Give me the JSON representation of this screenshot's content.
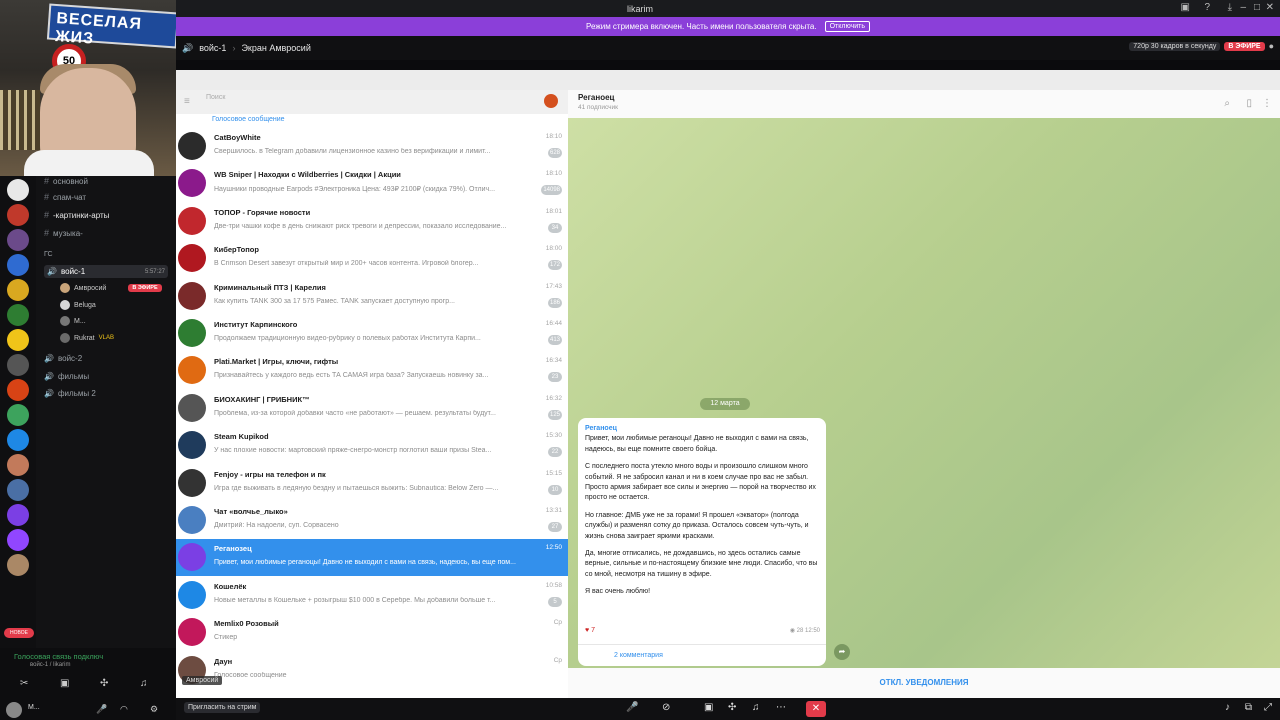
{
  "window": {
    "title": "likarim"
  },
  "stream_banner": {
    "text": "Режим стримера включен. Часть имени пользователя скрыта.",
    "button": "Отключить"
  },
  "voice_header": {
    "channel": "войс-1",
    "screen": "Экран Амвросий",
    "quality": "720p 30 кадров в секунду",
    "live": "В ЭФИРЕ"
  },
  "webcam": {
    "sign_text": "ВЕСЕЛАЯ ЖИЗ",
    "road_sign": "50"
  },
  "discord_channels": [
    {
      "label": "основной"
    },
    {
      "label": "спам-чат"
    },
    {
      "label": "-картинки-арты"
    },
    {
      "label": "музыка-"
    }
  ],
  "discord_group": "ГС",
  "voice_channel": {
    "label": "войс-1",
    "timer": "5:57:27"
  },
  "voice_users": [
    {
      "name": "Амвросий",
      "badge": "В ЭФИРЕ"
    },
    {
      "name": "Beluga"
    },
    {
      "name": "М..."
    },
    {
      "name": "Rukrat",
      "badge": "VLAB"
    }
  ],
  "other_voice": [
    {
      "label": "войс-2"
    },
    {
      "label": "фильмы"
    },
    {
      "label": "фильмы 2"
    }
  ],
  "discord_footer": {
    "status": "Голосовая связь подключ",
    "sub": "войс-1 / likarim",
    "user": "M..."
  },
  "invite_button": "Пригласить на стрим",
  "telegram": {
    "search_placeholder": "Поиск",
    "top_voice": "Голосовое сообщение",
    "chats": [
      {
        "name": "CatBoyWhite",
        "preview": "Свершилось. в Telegram добавили лицензионное казино без верификации и лимит...",
        "time": "18:10",
        "badge": "628"
      },
      {
        "name": "WB Sniper | Находки с Wildberries | Скидки | Акции",
        "preview": "Наушники проводные Earpods #Электроника Цена: 493₽ 2100₽ (скидка 79%). Отлич...",
        "time": "18:10",
        "badge": "14098"
      },
      {
        "name": "ТОПОР - Горячие новости",
        "preview": "Две-три чашки кофе в день снижают риск тревоги и депрессии, показало исследование...",
        "time": "18:01",
        "badge": "34"
      },
      {
        "name": "КиберТопор",
        "preview": "В Crimson Desert завезут открытый мир и 200+ часов контента. Игровой блогер...",
        "time": "18:00",
        "badge": "172"
      },
      {
        "name": "Криминальный ПТЗ | Карелия",
        "preview": "Как купить TANK 300 за 17 575 Рамес. TANK запускает доступную прогр...",
        "time": "17:43",
        "badge": "186"
      },
      {
        "name": "Институт Карпинского",
        "preview": "Продолжаем традиционную видео-рубрику о полевых работах Института Карпи...",
        "time": "16:44",
        "badge": "413"
      },
      {
        "name": "Plati.Market | Игры, ключи, гифты",
        "preview": "Признавайтесь у каждого ведь есть ТА САМАЯ игра база? Запускаешь новинку за...",
        "time": "16:34",
        "badge": "23"
      },
      {
        "name": "БИОХАКИНГ | ГРИБНИК™",
        "preview": "Проблема, из-за которой добавки часто «не работают» — решаем. результаты будут...",
        "time": "16:32",
        "badge": "125"
      },
      {
        "name": "Steam Kupikod",
        "preview": "У нас плохие новости: мартовский пряже-снегро-монстр поглотил ваши призы Stea...",
        "time": "15:30",
        "badge": "22"
      },
      {
        "name": "Fenjoy - игры на телефон и пк",
        "preview": "Игра где выживать в ледяную бездну и пытаешься выжить: Subnautica: Below Zero —...",
        "time": "15:15",
        "badge": "10"
      },
      {
        "name": "Чат «волчье_лыко»",
        "preview": "Дмитрий: На надоели, суп. Сорвасено",
        "time": "13:31",
        "badge": "27"
      },
      {
        "name": "Реганозец",
        "preview": "Привет, мои любимые реганоцы! Давно не выходил с вами на связь, надеюсь, вы еще пом...",
        "time": "12:50",
        "badge": ""
      },
      {
        "name": "Кошелёк",
        "preview": "Новые металлы в Кошельке + розыгрыш $10 000 в Серебре. Мы добавили больше т...",
        "time": "10:58",
        "badge": "5"
      },
      {
        "name": "Memlix0 Розовый",
        "preview": "Стикер",
        "time": "Ср",
        "badge": ""
      },
      {
        "name": "Даун",
        "preview": "Голосовое сообщение",
        "time": "Ср",
        "badge": ""
      }
    ],
    "channel": {
      "title": "Реганоец",
      "subs": "41 подписчик"
    },
    "date_badge": "12 марта",
    "message": {
      "author": "Реганоец",
      "paragraphs": [
        "Привет, мои любимые реганоцы! Давно не выходил с вами на связь, надеюсь, вы еще помните своего бойца.",
        "С последнего поста утекло много воды и произошло слишком много событий. Я не забросил канал и ни в коем случае про вас не забыл. Просто армия забирает все силы и энергию — порой на творчество их просто не остается.",
        "Но главное: ДМБ уже не за горами! Я прошел «экватор» (полгода службы) и разменял сотку до приказа. Осталось совсем чуть-чуть, и жизнь снова заиграет яркими красками.",
        "Да, многие отписались, не дождавшись, но здесь остались самые верные, сильные и по-настоящему близкие мне люди. Спасибо, что вы со мной, несмотря на тишину в эфире.",
        "Я вас очень люблю!"
      ],
      "reaction_count": "7",
      "views": "28",
      "time": "12:50",
      "comments": "2 комментария"
    },
    "footer": "ОТКЛ. УВЕДОМЛЕНИЯ",
    "overlay_name": "Амвросий"
  }
}
